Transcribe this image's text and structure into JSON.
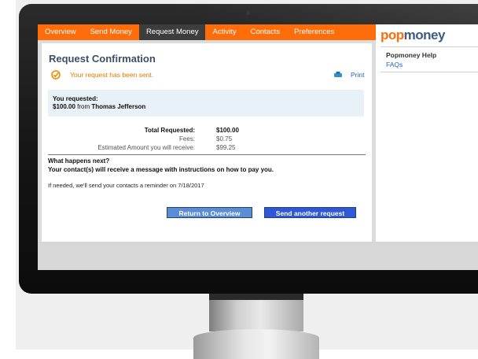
{
  "nav": {
    "items": [
      {
        "label": "Overview",
        "active": false
      },
      {
        "label": "Send Money",
        "active": false
      },
      {
        "label": "Request Money",
        "active": true
      },
      {
        "label": "Activity",
        "active": false
      },
      {
        "label": "Contacts",
        "active": false
      },
      {
        "label": "Preferences",
        "active": false
      }
    ]
  },
  "page": {
    "title": "Request Confirmation",
    "success_message": "Your request has been sent.",
    "print_label": "Print"
  },
  "request": {
    "label": "You requested:",
    "amount": "$100.00",
    "from_word": "from",
    "contact": "Thomas Jefferson"
  },
  "summary": {
    "total_label": "Total Requested:",
    "total_value": "$100.00",
    "fees_label": "Fees:",
    "fees_value": "$0.75",
    "estimated_label": "Estimated Amount you will receive:",
    "estimated_value": "$99.25"
  },
  "next_steps": {
    "title": "What happens next?",
    "message": "Your contact(s) will receive a message with instructions on how to pay you.",
    "reminder": "If needed, we'll send your contacts a reminder on 7/18/2017"
  },
  "buttons": {
    "return_overview": "Return to Overview",
    "send_another": "Send another request"
  },
  "sidebar": {
    "logo_pop": "pop",
    "logo_money": "money",
    "help_title": "Popmoney Help",
    "faqs": "FAQs"
  },
  "colors": {
    "brand_orange": "#ff6d0a",
    "brand_navy": "#3d5b86",
    "link_blue": "#2463c4",
    "active_tab": "#3d3d3d"
  },
  "icons": {
    "success": "check-circle-icon",
    "print": "printer-icon"
  }
}
